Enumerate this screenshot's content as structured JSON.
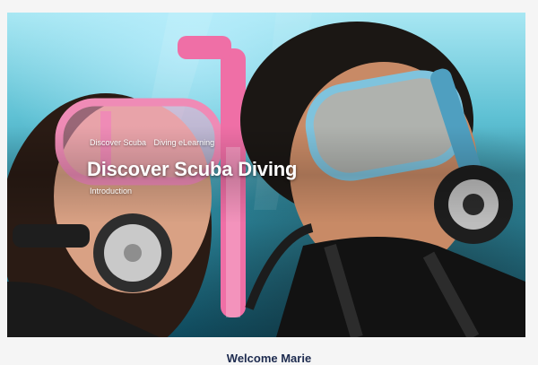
{
  "hero": {
    "breadcrumb": [
      "Discover Scuba",
      "Diving eLearning"
    ],
    "title": "Discover Scuba Diving",
    "subtitle": "Introduction"
  },
  "welcome_text": "Welcome Marie",
  "colors": {
    "water_light": "#a8e7f3",
    "water_dark": "#0f4d61",
    "pink_mask": "#f4a6c8",
    "blue_mask": "#9ad3ea",
    "heading_navy": "#1d2b4f"
  }
}
